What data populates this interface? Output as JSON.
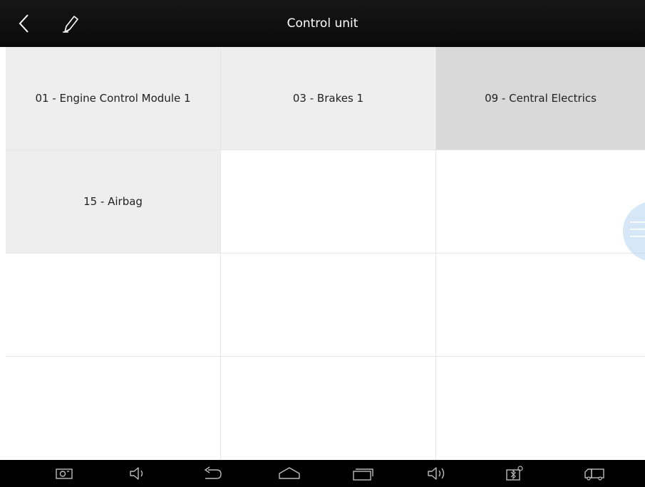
{
  "header": {
    "title": "Control unit",
    "back_icon": "chevron-left-icon",
    "edit_icon": "pencil-icon"
  },
  "grid": {
    "cells": [
      {
        "label": "01 - Engine Control Module 1"
      },
      {
        "label": "03 - Brakes 1"
      },
      {
        "label": "09 - Central Electrics"
      },
      {
        "label": "15 - Airbag"
      },
      {
        "label": ""
      },
      {
        "label": ""
      },
      {
        "label": ""
      },
      {
        "label": ""
      },
      {
        "label": ""
      },
      {
        "label": ""
      },
      {
        "label": ""
      },
      {
        "label": ""
      }
    ]
  },
  "navbar": {
    "icons": [
      "screenshot-icon",
      "volume-down-icon",
      "back-icon",
      "home-icon",
      "recent-apps-icon",
      "volume-up-icon",
      "vci-bluetooth-icon",
      "truck-icon"
    ]
  },
  "colors": {
    "topbar": "#111111",
    "filled_cell": "#eeeeee",
    "selected_cell": "#d9d9d9",
    "navbar": "#000000"
  }
}
